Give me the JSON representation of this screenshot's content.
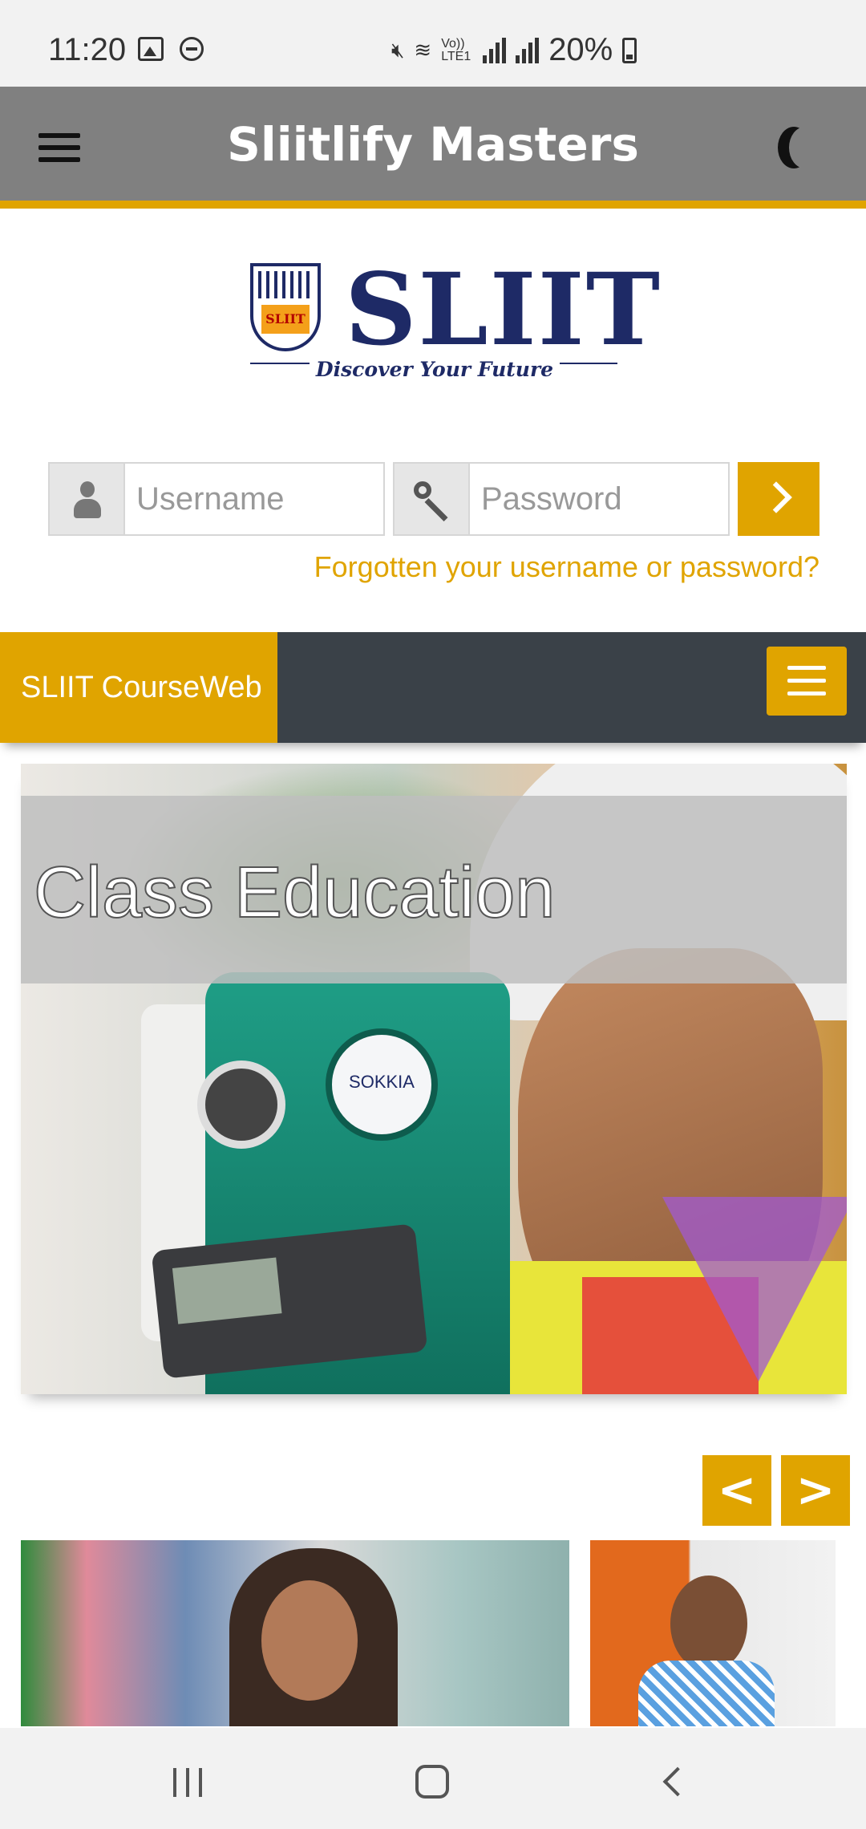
{
  "status_bar": {
    "time": "11:20",
    "network_label": "Vo)) LTE1",
    "battery_percent": "20%",
    "icons": [
      "image-icon",
      "dnd-icon",
      "mute-icon",
      "wifi-icon",
      "signal-icon",
      "signal-icon",
      "battery-icon"
    ]
  },
  "header": {
    "title": "Sliitlify Masters",
    "menu_icon": "hamburger-menu-icon",
    "theme_icon": "moon-icon"
  },
  "logo": {
    "wordmark": "SLIIT",
    "shield_text": "SLIIT",
    "tagline": "Discover Your Future"
  },
  "login": {
    "username_placeholder": "Username",
    "password_placeholder": "Password",
    "username_icon": "user-icon",
    "password_icon": "key-icon",
    "submit_icon": "chevron-right-icon",
    "forgot_link": "Forgotten your username or password?"
  },
  "course_nav": {
    "brand": "SLIIT CourseWeb",
    "toggle_icon": "hamburger-menu-icon"
  },
  "slider": {
    "caption": "Class Education",
    "instrument_brand": "SOKKIA"
  },
  "carousel": {
    "prev_label": "<",
    "next_label": ">"
  },
  "colors": {
    "accent": "#e0a400",
    "header_bg": "#808080",
    "nav_bg": "#3a4148",
    "logo_blue": "#1e2a66"
  }
}
